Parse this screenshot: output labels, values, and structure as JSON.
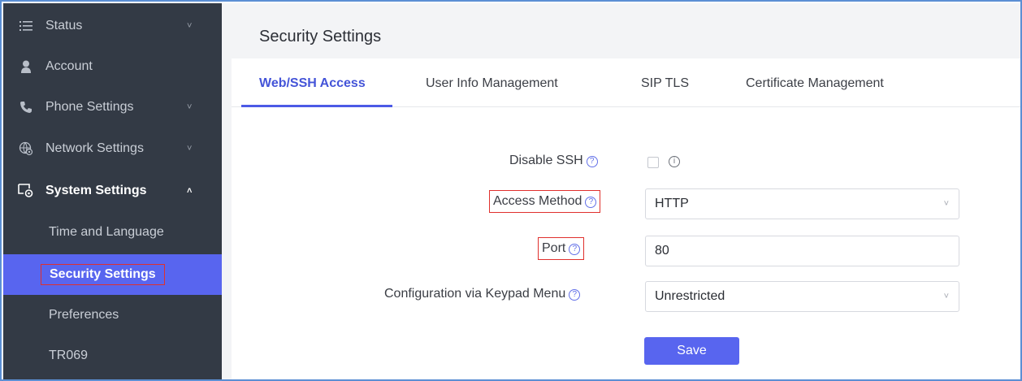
{
  "sidebar": {
    "items": [
      {
        "label": "Status",
        "icon": "list-icon",
        "chevron": "˅"
      },
      {
        "label": "Account",
        "icon": "user-icon",
        "chevron": ""
      },
      {
        "label": "Phone Settings",
        "icon": "phone-icon",
        "chevron": "˅"
      },
      {
        "label": "Network Settings",
        "icon": "network-icon",
        "chevron": "˅"
      },
      {
        "label": "System Settings",
        "icon": "system-settings-icon",
        "chevron": "˄"
      }
    ],
    "subitems": [
      {
        "label": "Time and Language"
      },
      {
        "label": "Security Settings"
      },
      {
        "label": "Preferences"
      },
      {
        "label": "TR069"
      }
    ]
  },
  "main": {
    "title": "Security Settings",
    "tabs": [
      {
        "label": "Web/SSH Access"
      },
      {
        "label": "User Info Management"
      },
      {
        "label": "SIP TLS"
      },
      {
        "label": "Certificate Management"
      }
    ],
    "form": {
      "disable_ssh": {
        "label": "Disable SSH",
        "checked": false
      },
      "access_method": {
        "label": "Access Method",
        "value": "HTTP"
      },
      "port": {
        "label": "Port",
        "value": "80"
      },
      "keypad_menu": {
        "label": "Configuration via Keypad Menu",
        "value": "Unrestricted"
      }
    },
    "save_label": "Save"
  },
  "colors": {
    "sidebar_bg": "#333a45",
    "accent": "#5865ef",
    "active_tab": "#4454d8",
    "highlight_box": "#e0302d"
  }
}
